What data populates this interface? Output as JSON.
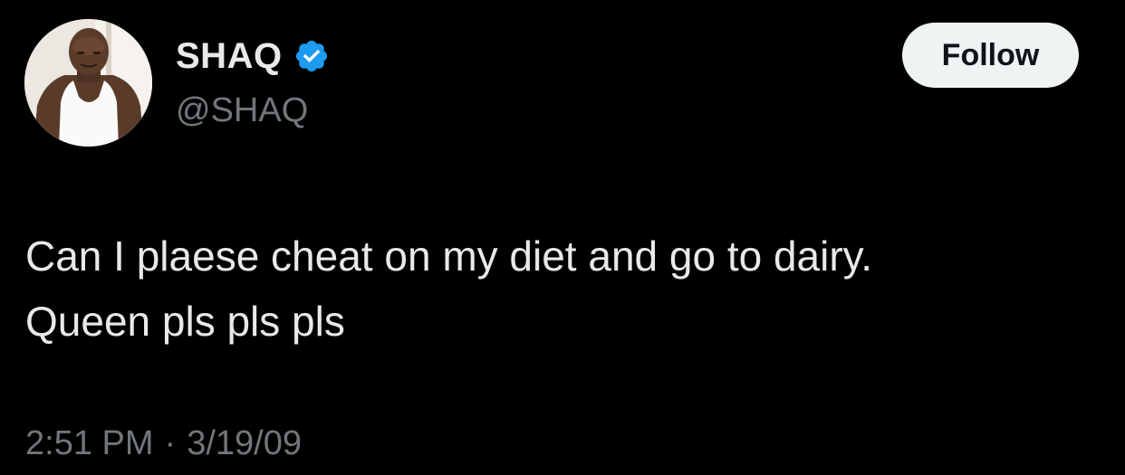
{
  "profile": {
    "display_name": "SHAQ",
    "handle": "@SHAQ",
    "verified": true,
    "verified_icon": "verified-badge-icon",
    "avatar_icon": "avatar"
  },
  "actions": {
    "follow_label": "Follow"
  },
  "tweet": {
    "lines": [
      "Can I plaese cheat on my diet and go to dairy.",
      "Queen pls pls pls"
    ]
  },
  "meta": {
    "time": "2:51 PM",
    "separator": "·",
    "date": "3/19/09"
  },
  "colors": {
    "background": "#000000",
    "primary_text": "#e7e9ea",
    "secondary_text": "#71767b",
    "verified_blue": "#1d9bf0",
    "follow_bg": "#eff3f4",
    "follow_text": "#0f1419"
  }
}
